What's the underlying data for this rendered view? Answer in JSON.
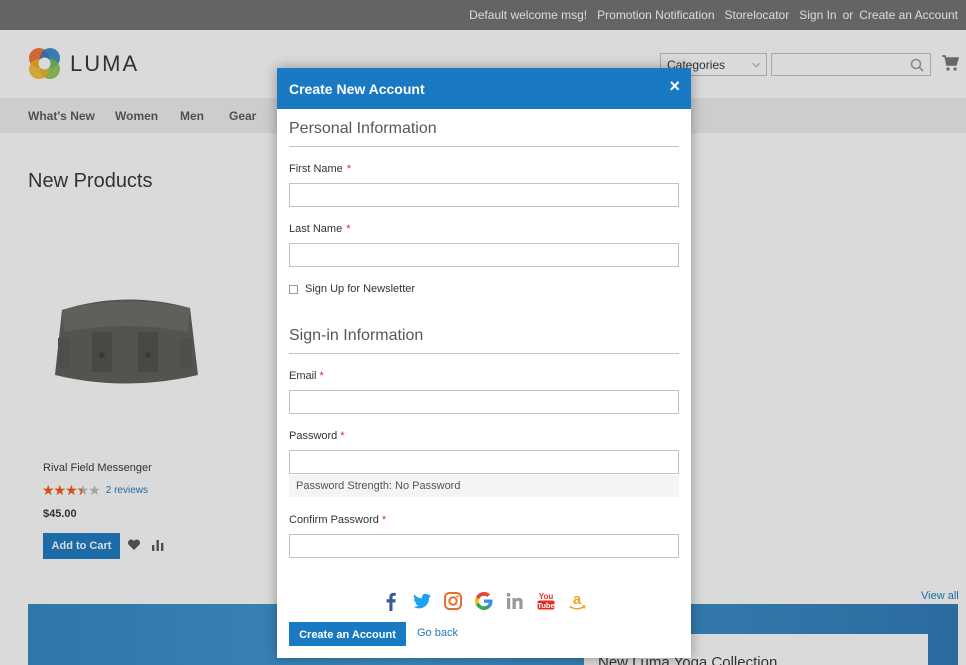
{
  "topbar": {
    "welcome": "Default welcome msg!",
    "promotion": "Promotion Notification",
    "storelocator": "Storelocator",
    "sign_in": "Sign In",
    "or": "or",
    "create_account": "Create an Account"
  },
  "header": {
    "logo_text": "LUMA",
    "categories_select": "Categories",
    "search_placeholder": ""
  },
  "nav": {
    "items": [
      "What's New",
      "Women",
      "Men",
      "Gear"
    ]
  },
  "main": {
    "section_title": "New Products",
    "product": {
      "name": "Rival Field Messenger",
      "rating": 3.5,
      "rating_max": 5,
      "reviews": "2 reviews",
      "price": "$45.00",
      "add_to_cart": "Add to Cart"
    },
    "view_all": "View all",
    "banner_text": "New Luma Yoga Collection"
  },
  "modal": {
    "title": "Create New Account",
    "close": "×",
    "personal_legend": "Personal Information",
    "first_name_label": "First Name",
    "last_name_label": "Last Name",
    "required_mark": "*",
    "newsletter_label": "Sign Up for Newsletter",
    "signin_legend": "Sign-in Information",
    "email_label": "Email",
    "password_label": "Password",
    "password_strength": "Password Strength: No Password",
    "confirm_password_label": "Confirm Password",
    "social_icons": [
      "facebook-icon",
      "twitter-icon",
      "instagram-icon",
      "google-icon",
      "linkedin-icon",
      "youtube-icon",
      "amazon-icon"
    ],
    "create_button": "Create an Account",
    "go_back": "Go back"
  },
  "colors": {
    "primary": "#1979c3",
    "topbar": "#6e716e",
    "nav_bg": "#f0f0f0",
    "required": "#e02b27",
    "star": "#ff5501"
  }
}
